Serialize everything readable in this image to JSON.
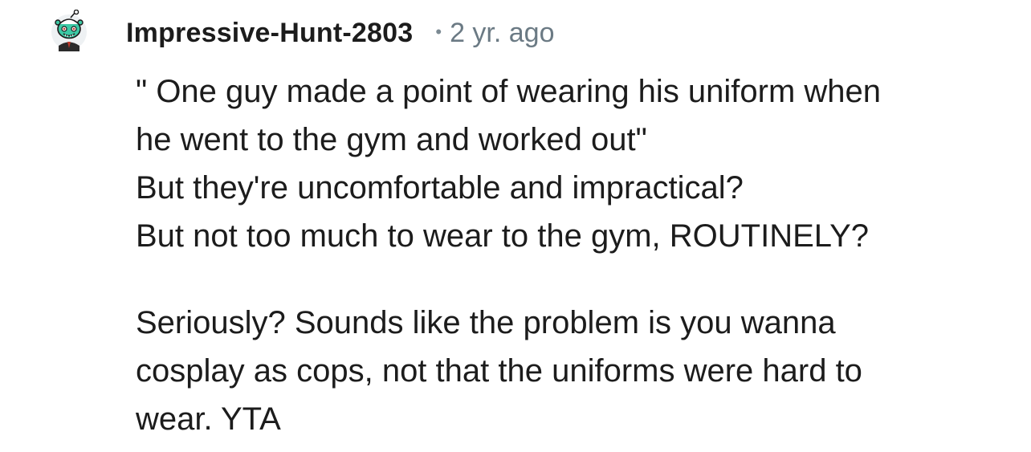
{
  "comment": {
    "author": "Impressive-Hunt-2803",
    "separator": "•",
    "timestamp": "2 yr. ago",
    "avatar_icon": "snoo-avatar-icon",
    "paragraph1_lines": [
      "\" One guy made a point of wearing his uniform when",
      "he went to the gym and worked out\"",
      "But they're uncomfortable and impractical?",
      "But not too much to wear to the gym, ROUTINELY?"
    ],
    "paragraph2_lines": [
      "Seriously? Sounds like the problem is you wanna",
      "cosplay as cops, not that the uniforms were hard to",
      "wear. YTA"
    ]
  },
  "colors": {
    "text": "#1c1c1c",
    "meta": "#6b7a84",
    "avatar_face": "#3cc9a5",
    "avatar_outline": "#1a1a1a"
  }
}
